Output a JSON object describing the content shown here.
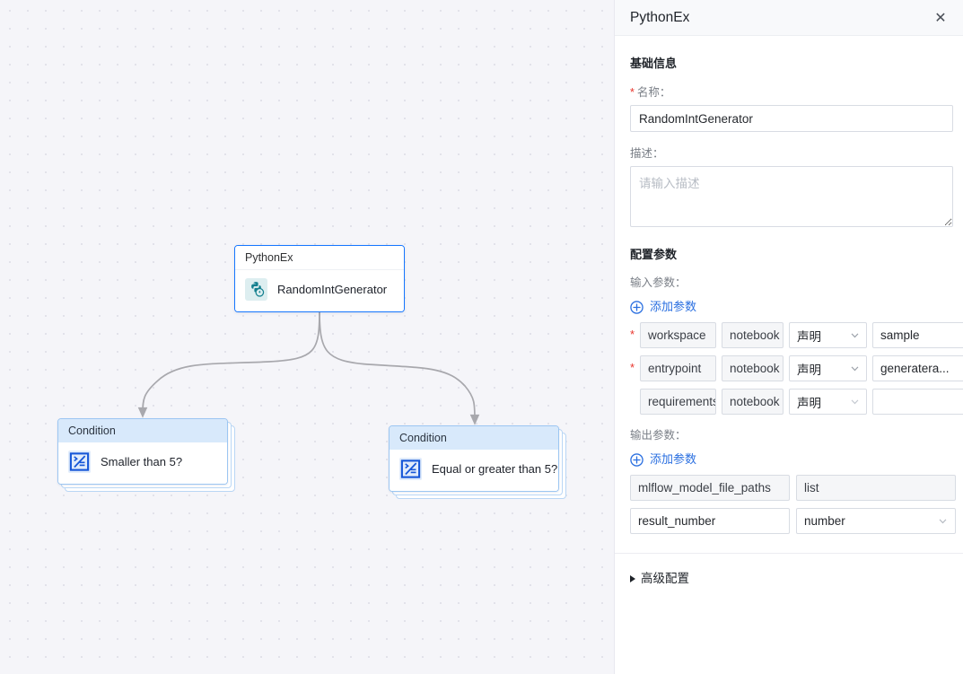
{
  "canvas": {
    "nodes": [
      {
        "id": "python-node",
        "title": "PythonEx",
        "label": "RandomIntGenerator",
        "icon": "python-icon",
        "selected": true
      },
      {
        "id": "condition-left",
        "title": "Condition",
        "label": "Smaller than 5?",
        "icon": "condition-icon",
        "selected": false
      },
      {
        "id": "condition-right",
        "title": "Condition",
        "label": "Equal or greater than 5?",
        "icon": "condition-icon",
        "selected": false
      }
    ],
    "background_color": "#f5f5f9",
    "edge_color": "#a8a8ad",
    "selected_border_color": "#1677ff"
  },
  "panel": {
    "title": "PythonEx",
    "close_label": "✕",
    "basic_section": {
      "heading": "基础信息",
      "name_label": "名称：",
      "name_required": "*",
      "name_value": "RandomIntGenerator",
      "desc_label": "描述：",
      "desc_value": "",
      "desc_placeholder": "请输入描述"
    },
    "config_section": {
      "heading": "配置参数",
      "input_label": "输入参数：",
      "output_label": "输出参数：",
      "add_param_label": "添加参数",
      "input_params": [
        {
          "required": true,
          "name": "workspace",
          "kind": "notebook",
          "source": "声明",
          "value": "sample"
        },
        {
          "required": true,
          "name": "entrypoint",
          "kind": "notebook",
          "source": "声明",
          "value": "generatera..."
        },
        {
          "required": false,
          "name": "requirements",
          "kind": "notebook",
          "source": "声明",
          "value": ""
        }
      ],
      "output_params": [
        {
          "name": "mlflow_model_file_paths",
          "type": "list",
          "has_dropdown": false
        },
        {
          "name": "result_number",
          "type": "number",
          "has_dropdown": true
        }
      ]
    },
    "advanced_section": {
      "label": "高级配置"
    },
    "accent_color": "#2a6fe0",
    "required_color": "#e8342b"
  }
}
